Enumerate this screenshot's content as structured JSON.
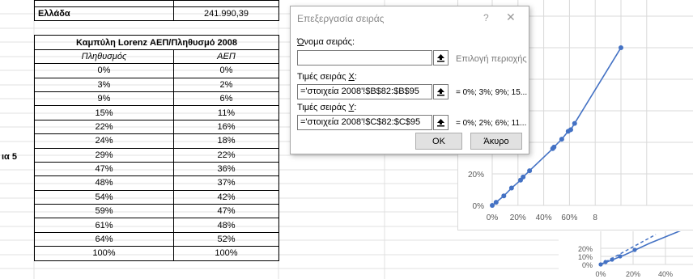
{
  "sheet": {
    "top_row": {
      "label": "",
      "value": ""
    },
    "greece_row": {
      "label": "Ελλάδα",
      "value": "241.990,39"
    },
    "table_title": "Καμπύλη Lorenz ΑΕΠ/Πληθυσμό 2008",
    "col_headers": [
      "Πληθυσμός",
      "ΑΕΠ"
    ],
    "rows": [
      [
        "0%",
        "0%"
      ],
      [
        "3%",
        "2%"
      ],
      [
        "9%",
        "6%"
      ],
      [
        "15%",
        "11%"
      ],
      [
        "22%",
        "16%"
      ],
      [
        "24%",
        "18%"
      ],
      [
        "29%",
        "22%"
      ],
      [
        "47%",
        "36%"
      ],
      [
        "48%",
        "37%"
      ],
      [
        "54%",
        "42%"
      ],
      [
        "59%",
        "47%"
      ],
      [
        "61%",
        "48%"
      ],
      [
        "64%",
        "52%"
      ],
      [
        "100%",
        "100%"
      ]
    ],
    "side_label": "ια 5"
  },
  "dialog": {
    "title": "Επεξεργασία σειράς",
    "help": "?",
    "close": "✕",
    "name_label": "Όνομα σειράς:",
    "name_value": "",
    "name_hint": "Επιλογή περιοχής",
    "x_label": "Τιμές σειράς X:",
    "x_value": "='στοιχεία 2008'!$B$82:$B$95",
    "x_preview": "= 0%; 3%; 9%; 15...",
    "y_label": "Τιμές σειράς Y:",
    "y_value": "='στοιχεία 2008'!$C$82:$C$95",
    "y_preview": "= 0%; 2%; 6%; 11...",
    "ok": "OK",
    "cancel": "Άκυρο"
  },
  "chart_data": [
    {
      "type": "scatter",
      "x_ticks": [
        "0%",
        "20%",
        "40%",
        "60%",
        "8"
      ],
      "y_ticks": [
        "0%",
        "20%"
      ],
      "x": [
        0,
        3,
        9,
        15,
        22,
        24,
        29,
        47,
        48,
        54,
        59,
        61,
        64,
        100
      ],
      "y": [
        0,
        2,
        6,
        11,
        16,
        18,
        22,
        36,
        37,
        42,
        47,
        48,
        52,
        100
      ],
      "color": "#4472c4"
    },
    {
      "type": "line",
      "x_ticks": [
        "0%",
        "20%",
        "40%"
      ],
      "y_ticks": [
        "20%",
        "10%",
        "0%"
      ],
      "color": "#4472c4"
    }
  ]
}
